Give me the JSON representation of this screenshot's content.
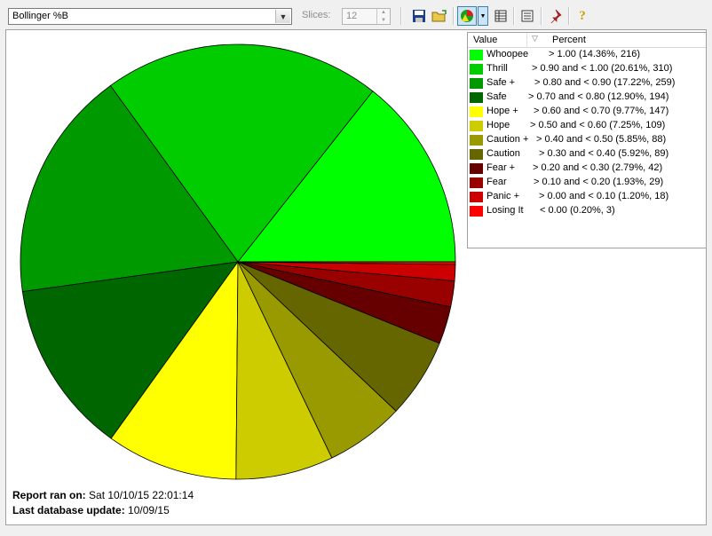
{
  "toolbar": {
    "indicator_value": "Bollinger %B",
    "slices_label": "Slices:",
    "slices_value": "12",
    "icons": [
      "save-icon",
      "open-folder-icon",
      "pie-chart-icon",
      "table-icon",
      "list-icon",
      "pin-icon",
      "help-icon"
    ]
  },
  "legend": {
    "col_value": "Value",
    "col_percent": "Percent",
    "rows": [
      {
        "label": "Whoopee",
        "percent": "> 1.00 (14.36%, 216)",
        "color": "#00ff00"
      },
      {
        "label": "Thrill",
        "percent": "> 0.90 and < 1.00 (20.61%, 310)",
        "color": "#00cc00"
      },
      {
        "label": "Safe +",
        "percent": "> 0.80 and < 0.90 (17.22%, 259)",
        "color": "#009900"
      },
      {
        "label": "Safe",
        "percent": "> 0.70 and < 0.80 (12.90%, 194)",
        "color": "#006600"
      },
      {
        "label": "Hope +",
        "percent": "> 0.60 and < 0.70 (9.77%, 147)",
        "color": "#ffff00"
      },
      {
        "label": "Hope",
        "percent": "> 0.50 and < 0.60 (7.25%, 109)",
        "color": "#cccc00"
      },
      {
        "label": "Caution +",
        "percent": "> 0.40 and < 0.50 (5.85%, 88)",
        "color": "#999900"
      },
      {
        "label": "Caution",
        "percent": "> 0.30 and < 0.40 (5.92%, 89)",
        "color": "#666600"
      },
      {
        "label": "Fear +",
        "percent": "> 0.20 and < 0.30 (2.79%, 42)",
        "color": "#660000"
      },
      {
        "label": "Fear",
        "percent": "> 0.10 and < 0.20 (1.93%, 29)",
        "color": "#990000"
      },
      {
        "label": "Panic +",
        "percent": "> 0.00 and < 0.10 (1.20%, 18)",
        "color": "#cc0000"
      },
      {
        "label": "Losing It",
        "percent": "< 0.00 (0.20%, 3)",
        "color": "#ff0000"
      }
    ]
  },
  "chart_data": {
    "type": "pie",
    "categories": [
      "Whoopee",
      "Thrill",
      "Safe +",
      "Safe",
      "Hope +",
      "Hope",
      "Caution +",
      "Caution",
      "Fear +",
      "Fear",
      "Panic +",
      "Losing It"
    ],
    "values": [
      14.36,
      20.61,
      17.22,
      12.9,
      9.77,
      7.25,
      5.85,
      5.92,
      2.79,
      1.93,
      1.2,
      0.2
    ],
    "counts": [
      216,
      310,
      259,
      194,
      147,
      109,
      88,
      89,
      42,
      29,
      18,
      3
    ],
    "colors": [
      "#00ff00",
      "#00cc00",
      "#009900",
      "#006600",
      "#ffff00",
      "#cccc00",
      "#999900",
      "#666600",
      "#660000",
      "#990000",
      "#cc0000",
      "#ff0000"
    ],
    "start": "3 o'clock",
    "direction": "counterclockwise"
  },
  "footer": {
    "report_label": "Report ran on:",
    "report_value": "Sat 10/10/15 22:01:14",
    "update_label": "Last database update:",
    "update_value": "10/09/15"
  }
}
